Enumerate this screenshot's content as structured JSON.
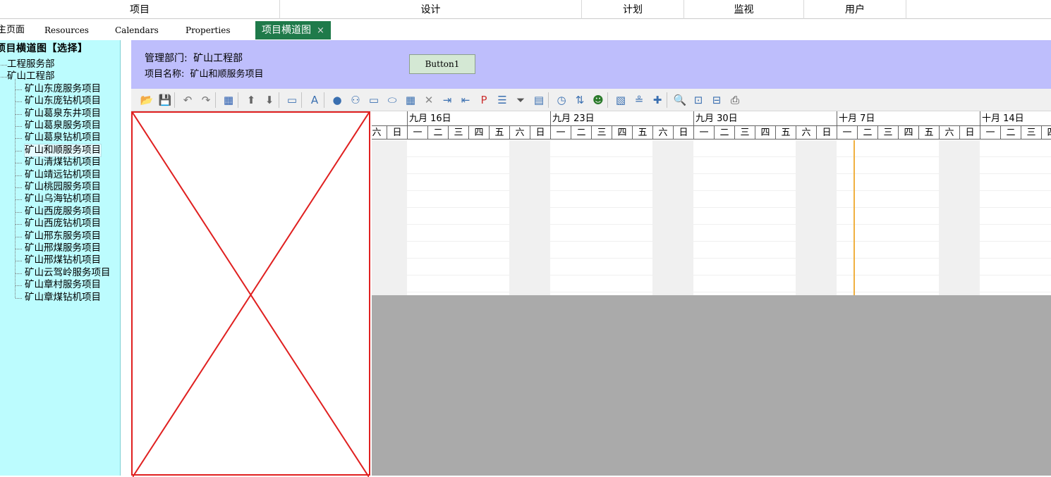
{
  "menu": {
    "items": [
      "项目",
      "设计",
      "计划",
      "监视",
      "用户"
    ]
  },
  "tabs": {
    "items": [
      "主页面",
      "Resources",
      "Calendars",
      "Properties"
    ],
    "active": "项目横道图",
    "close_glyph": "×"
  },
  "tree": {
    "title": "项目横道图【选择】",
    "roots": [
      "工程服务部",
      "矿山工程部"
    ],
    "children": [
      "矿山东庞服务项目",
      "矿山东庞钻机项目",
      "矿山葛泉东井项目",
      "矿山葛泉服务项目",
      "矿山葛泉钻机项目",
      "矿山和顺服务项目",
      "矿山清煤钻机项目",
      "矿山靖远钻机项目",
      "矿山桃园服务项目",
      "矿山乌海钻机项目",
      "矿山西庞服务项目",
      "矿山西庞钻机项目",
      "矿山邢东服务项目",
      "矿山邢煤服务项目",
      "矿山邢煤钻机项目",
      "矿山云驾岭服务项目",
      "矿山章村服务项目",
      "矿山章煤钻机项目"
    ],
    "selected_index": 5
  },
  "header": {
    "dept_label": "管理部门:",
    "dept_value": "矿山工程部",
    "project_label": "项目名称:",
    "project_value": "矿山和顺服务项目",
    "button_label": "Button1"
  },
  "toolbar": {
    "icons": [
      "open-folder-icon",
      "save-icon",
      "undo-icon",
      "redo-icon",
      "grid-icon",
      "move-up-icon",
      "move-down-icon",
      "form-icon",
      "font-icon",
      "add-task-icon",
      "binoculars-icon",
      "rectangle-icon",
      "link-icon",
      "calendar-icon",
      "delete-icon",
      "indent-icon",
      "outdent-icon",
      "pm-icon",
      "layout-icon",
      "filter-icon",
      "table-view-icon",
      "schedule-icon",
      "resource-icon",
      "users-icon",
      "report-icon",
      "level-icon",
      "pin-icon",
      "zoom-icon",
      "zoom-fit-icon",
      "zoom-out-icon",
      "print-icon"
    ]
  },
  "gantt": {
    "weeks": [
      "九月 16日",
      "九月 23日",
      "九月 30日",
      "十月 7日",
      "十月 14日"
    ],
    "day_names": [
      "六",
      "日",
      "一",
      "二",
      "三",
      "四",
      "五",
      "六",
      "日",
      "一",
      "二",
      "三",
      "四",
      "五",
      "六",
      "日",
      "一",
      "二",
      "三",
      "四",
      "五",
      "六",
      "日",
      "一",
      "二",
      "三",
      "四",
      "五",
      "六",
      "日",
      "一",
      "二",
      "三",
      "四"
    ]
  }
}
